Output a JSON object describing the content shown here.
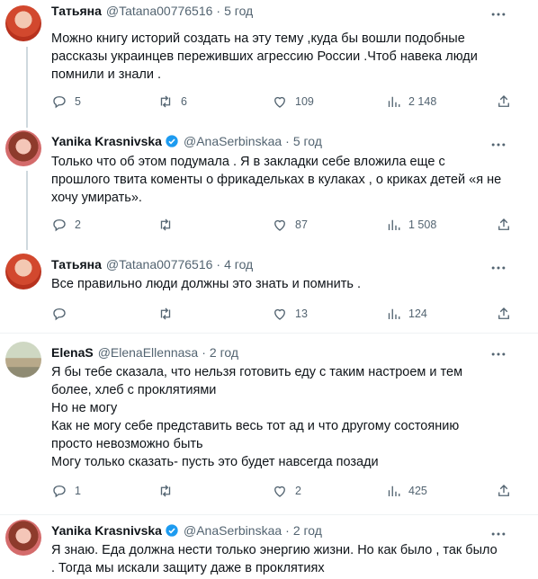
{
  "tweets": [
    {
      "name": "Татьяна",
      "handle": "@Tatana00776516",
      "time": "5 год",
      "verified": false,
      "text": [
        "Можно книгу историй создать на эту тему ,куда бы вошли подобные",
        "рассказы украинцев переживших агрессию России .Чтоб навека люди",
        "помнили и знали ."
      ],
      "replies": "5",
      "retweets": "6",
      "likes": "109",
      "views": "2 148"
    },
    {
      "name": "Yanika Krasnivska",
      "handle": "@AnaSerbinskaa",
      "time": "5 год",
      "verified": true,
      "text": [
        "Только что об этом подумала . Я в закладки себе вложила еще с",
        "прошлого твита коменты о фрикадельках в кулаках , о криках детей «я не",
        "хочу умирать»."
      ],
      "replies": "2",
      "retweets": "",
      "likes": "87",
      "views": "1 508"
    },
    {
      "name": "Татьяна",
      "handle": "@Tatana00776516",
      "time": "4 год",
      "verified": false,
      "text": [
        "Все правильно люди должны это знать и помнить ."
      ],
      "replies": "",
      "retweets": "",
      "likes": "13",
      "views": "124"
    },
    {
      "name": "ElenaS",
      "handle": "@ElenaEllennasa",
      "time": "2 год",
      "verified": false,
      "text": [
        "Я бы тебе сказала, что нельзя готовить еду с таким настроем и тем",
        "более, хлеб с проклятиями",
        "Но не могу",
        "Как не могу себе представить весь тот ад и что другому состоянию",
        "просто невозможно быть",
        "Могу только сказать- пусть это будет навсегда позади"
      ],
      "replies": "1",
      "retweets": "",
      "likes": "2",
      "views": "425"
    },
    {
      "name": "Yanika Krasnivska",
      "handle": "@AnaSerbinskaa",
      "time": "2 год",
      "verified": true,
      "text": [
        "Я знаю. Еда должна нести только энергию жизни. Но как было , так было",
        ". Тогда мы искали защиту даже в проклятиях"
      ],
      "replies": "",
      "retweets": "",
      "likes": "",
      "views": ""
    }
  ],
  "colors": {
    "verified": "#1d9bf0",
    "muted": "#536471",
    "thread_line": "#cfd9de"
  }
}
